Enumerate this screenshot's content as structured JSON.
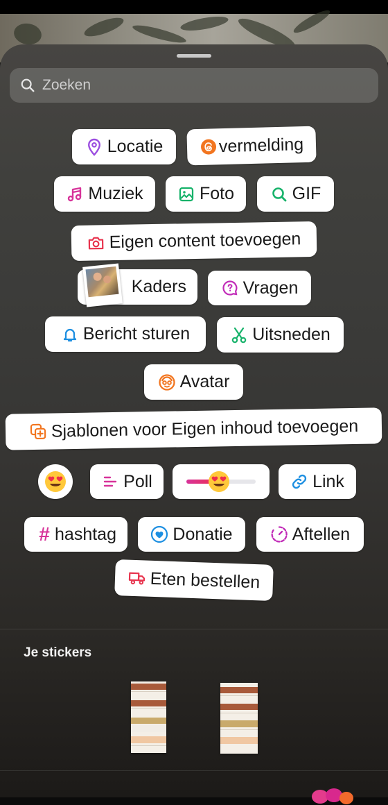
{
  "search": {
    "placeholder": "Zoeken"
  },
  "stickers": {
    "locatie": "Locatie",
    "vermelding": "vermelding",
    "muziek": "Muziek",
    "foto": "Foto",
    "gif": "GIF",
    "eigen_content": "Eigen content toevoegen",
    "kaders": "Kaders",
    "vragen": "Vragen",
    "bericht": "Bericht sturen",
    "uitsneden": "Uitsneden",
    "avatar": "Avatar",
    "sjablonen": "Sjablonen voor Eigen inhoud toevoegen",
    "poll": "Poll",
    "link": "Link",
    "hashtag": "hashtag",
    "donatie": "Donatie",
    "aftellen": "Aftellen",
    "eten": "Eten bestellen"
  },
  "my_stickers": {
    "title": "Je stickers"
  },
  "icons": {
    "search": "search-icon",
    "location": "location-pin-icon",
    "threads": "threads-icon",
    "music": "music-note-icon",
    "photo": "photo-icon",
    "gif": "gif-search-icon",
    "camera": "camera-icon",
    "question": "question-icon",
    "bell": "bell-icon",
    "scissors": "scissors-icon",
    "avatar": "avatar-icon",
    "templates": "templates-add-icon",
    "poll": "poll-icon",
    "link": "link-icon",
    "heart": "heart-donation-icon",
    "countdown": "countdown-icon",
    "food": "food-delivery-icon",
    "emoji": "heart-eyes-emoji-icon"
  },
  "colors": {
    "purple": "#9b4de0",
    "orange": "#f2751f",
    "pink": "#d7339a",
    "green": "#16b26a",
    "blue": "#1d8fe1",
    "red": "#e8344e",
    "magenta": "#c12bb8"
  }
}
